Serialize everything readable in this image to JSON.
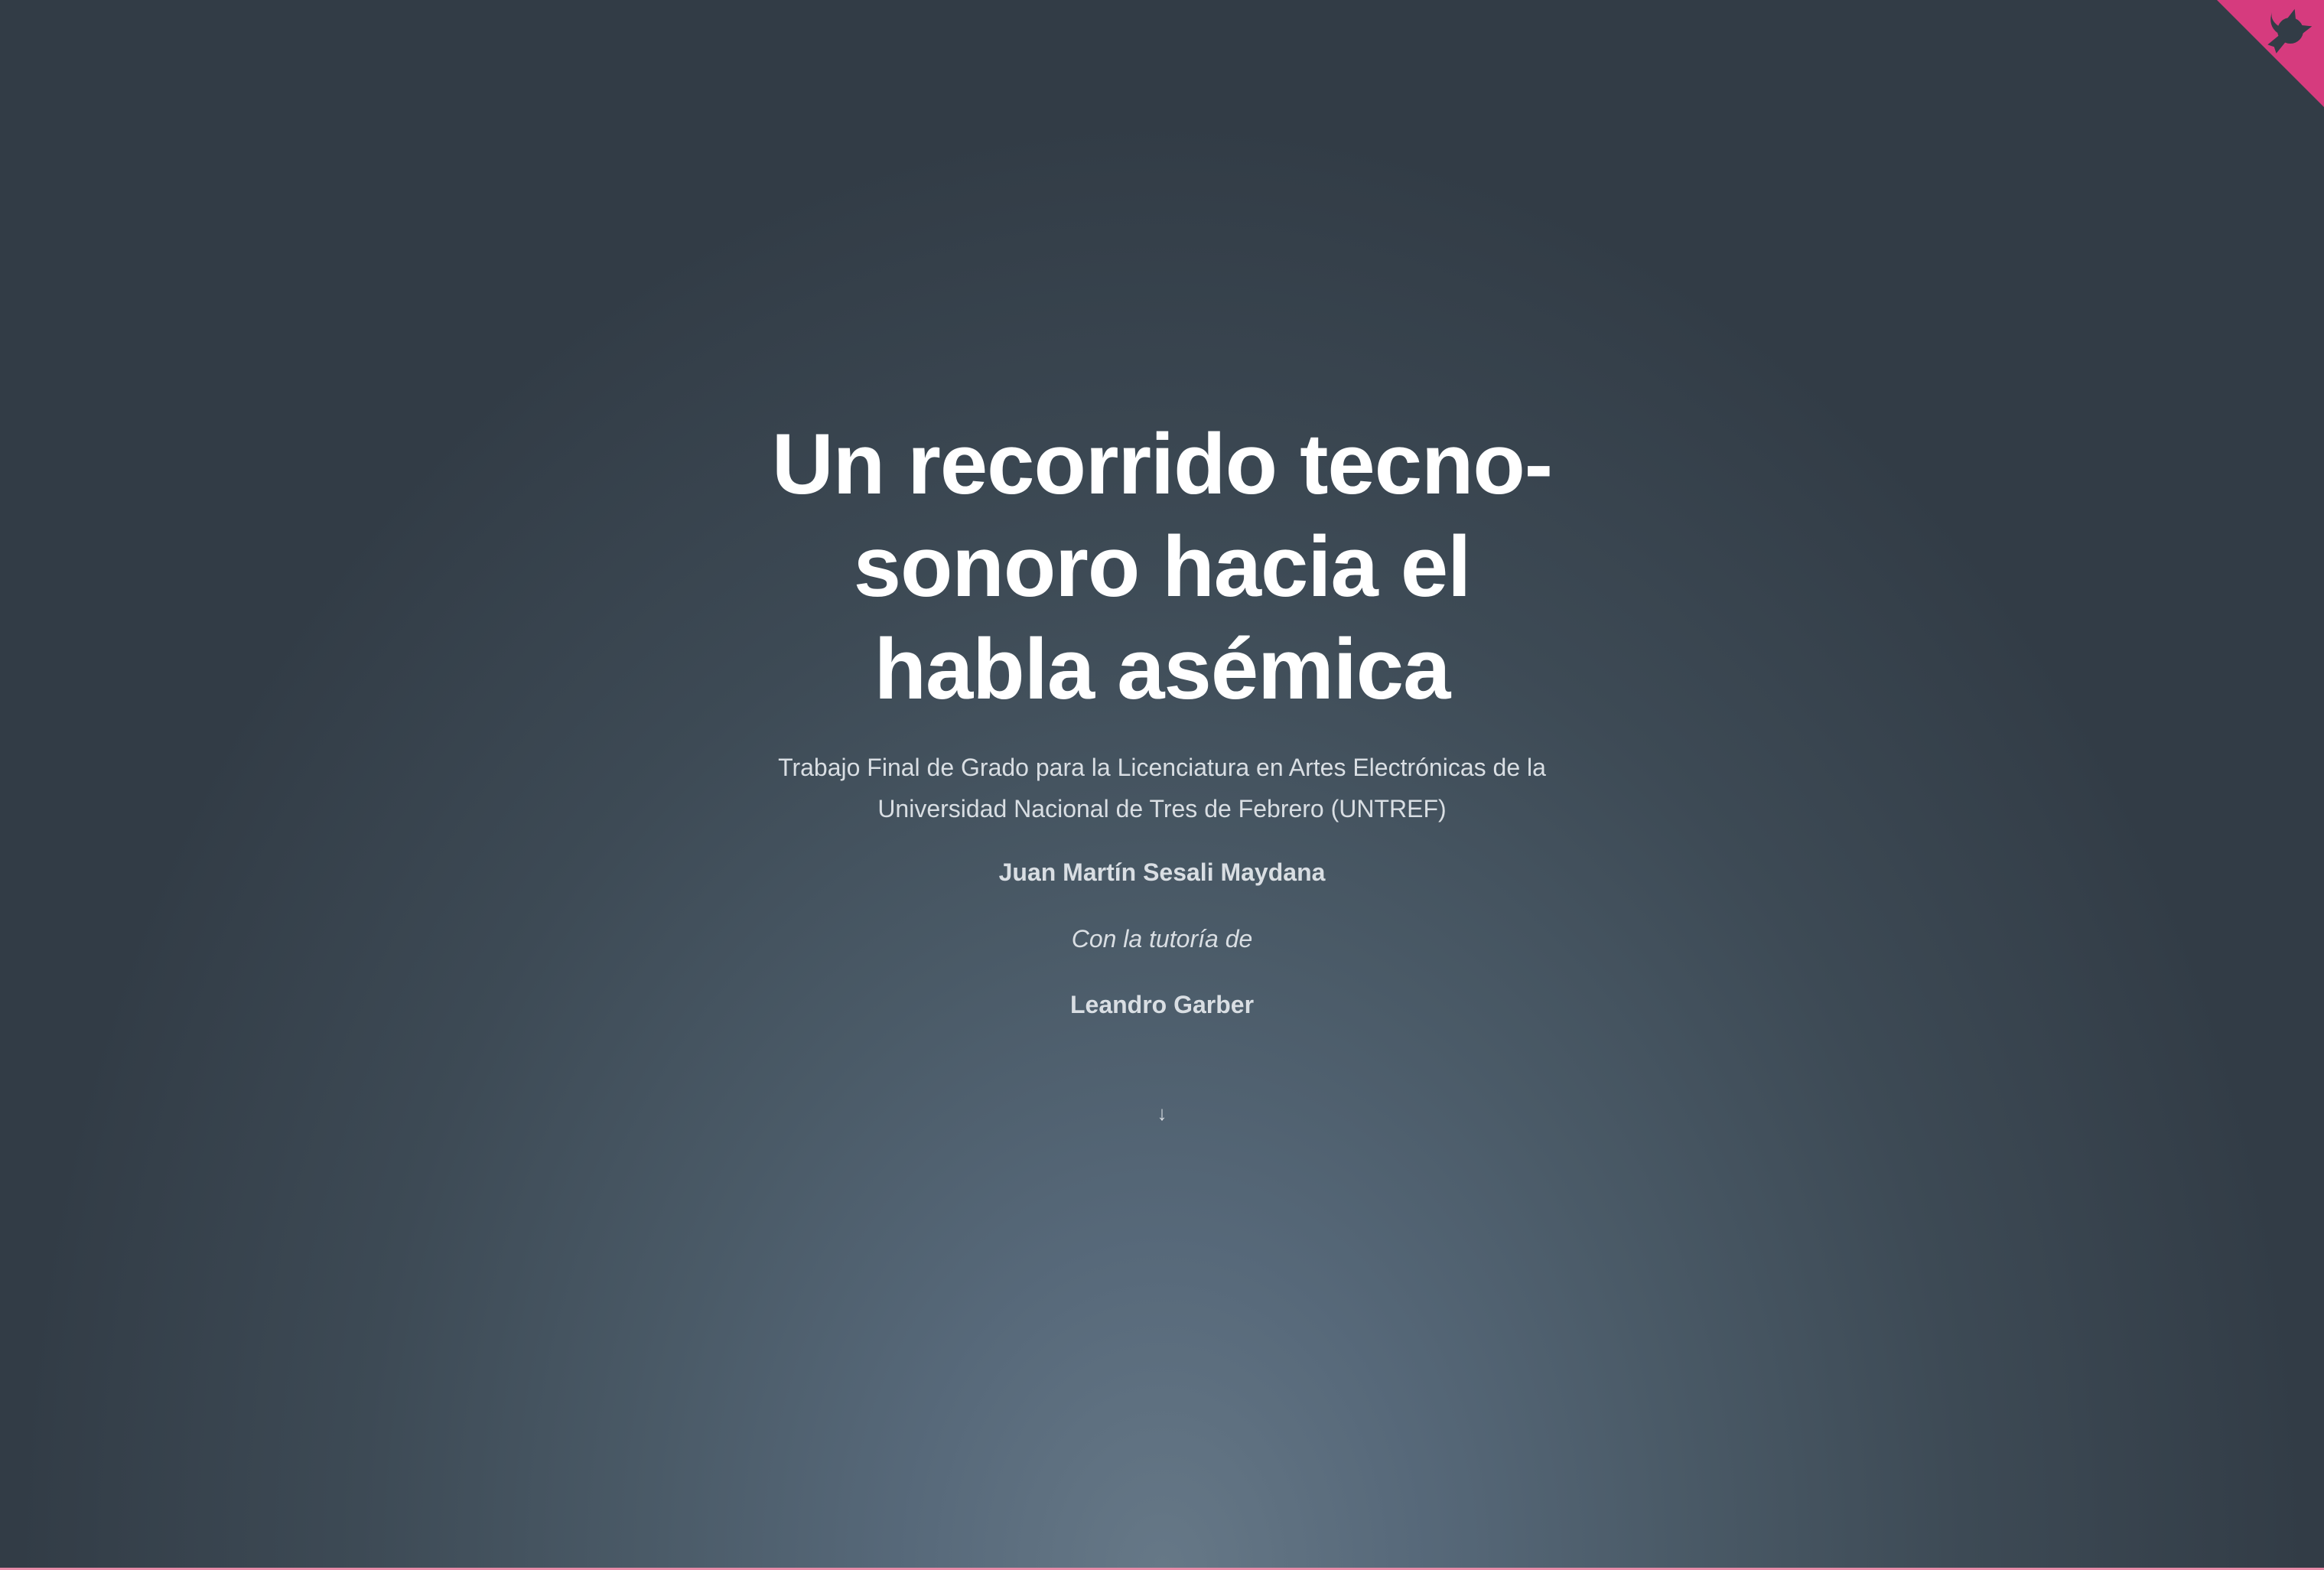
{
  "cover": {
    "title": "Un recorrido tecno-sonoro hacia el habla asémica",
    "subtitle": "Trabajo Final de Grado para la Licenciatura en Artes Electrónicas de la Universidad Nacional de Tres de Febrero (UNTREF)",
    "author": "Juan Martín Sesali Maydana",
    "tutor_intro": "Con la tutoría de",
    "tutor": "Leandro Garber",
    "scroll_arrow": "↓"
  },
  "corner": {
    "icon": "github-octocat-icon",
    "color": "#d63b7e",
    "icon_color": "#323c46"
  },
  "colors": {
    "background_center": "#667887",
    "background_edge": "#323c46",
    "title": "#ffffff",
    "text": "#d9dee3",
    "bottom_strip": "#e98aa8"
  }
}
